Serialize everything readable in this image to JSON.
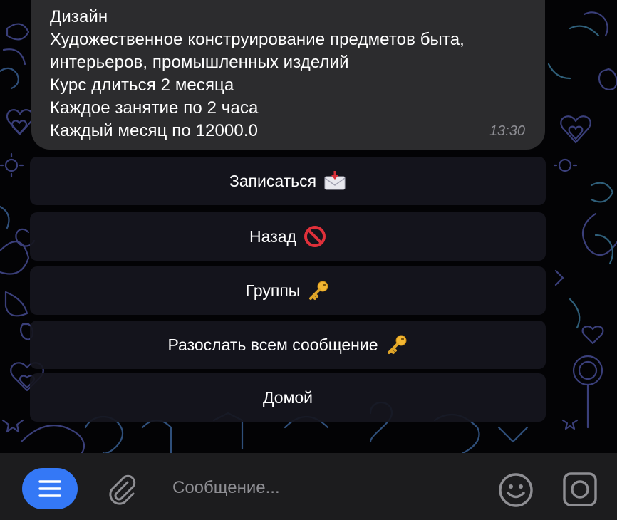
{
  "message": {
    "lines": [
      "Дизайн",
      "Художественное конструирование предметов быта,",
      "интерьеров, промышленных изделий",
      "Курс длиться 2 месяца",
      "Каждое занятие по 2 часа",
      "Каждый месяц по 12000.0"
    ],
    "time": "13:30"
  },
  "keyboard": {
    "buttons": [
      {
        "label": "Записаться",
        "icon": "incoming-envelope-emoji"
      },
      {
        "label": "Назад",
        "icon": "prohibited-emoji"
      },
      {
        "label": "Группы",
        "icon": "key-emoji"
      },
      {
        "label": "Разослать всем сообщение",
        "icon": "key-emoji"
      },
      {
        "label": "Домой",
        "icon": ""
      }
    ]
  },
  "input": {
    "placeholder": "Сообщение...",
    "value": ""
  },
  "colors": {
    "accent": "#3478f6",
    "bubble": "#2c2c2e",
    "bar": "#1c1c1e",
    "wallpaper_line": "#2a3a5a"
  },
  "icons": {
    "menu": "menu-icon",
    "attach": "paperclip-icon",
    "sticker": "smiley-icon",
    "camera": "camera-icon"
  }
}
